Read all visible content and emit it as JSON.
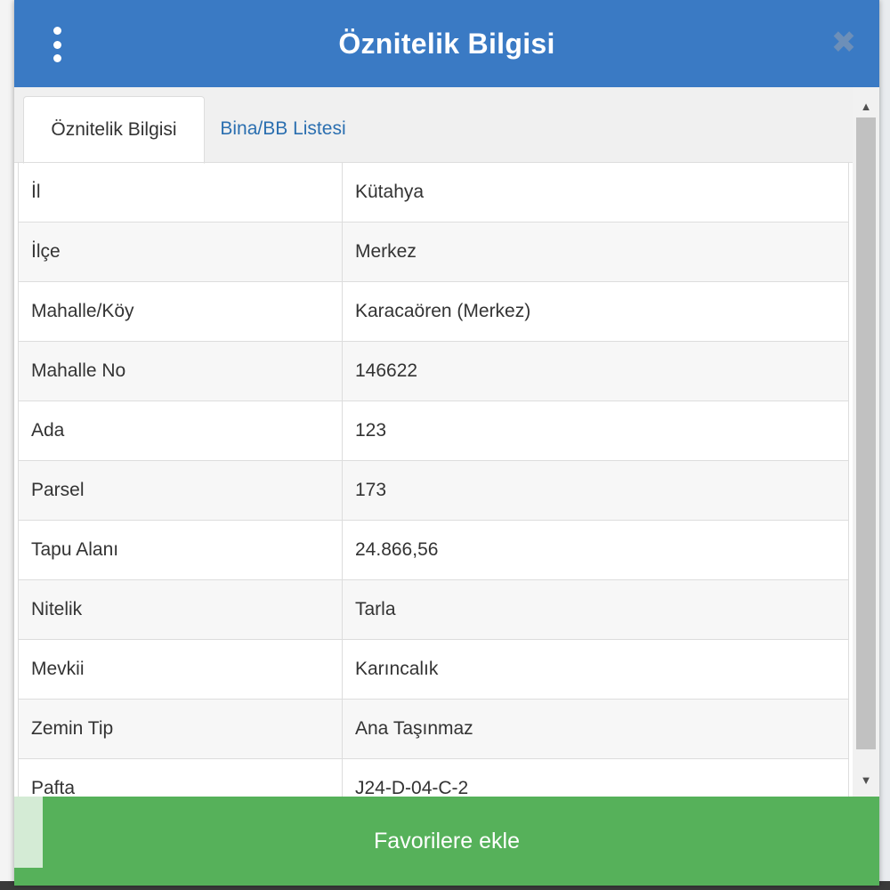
{
  "header": {
    "title": "Öznitelik Bilgisi"
  },
  "tabs": [
    {
      "label": "Öznitelik Bilgisi",
      "active": true
    },
    {
      "label": "Bina/BB Listesi",
      "active": false
    }
  ],
  "attributes": [
    {
      "key": "İl",
      "value": "Kütahya"
    },
    {
      "key": "İlçe",
      "value": "Merkez"
    },
    {
      "key": "Mahalle/Köy",
      "value": "Karacaören (Merkez)"
    },
    {
      "key": "Mahalle No",
      "value": "146622"
    },
    {
      "key": "Ada",
      "value": "123"
    },
    {
      "key": "Parsel",
      "value": "173"
    },
    {
      "key": "Tapu Alanı",
      "value": "24.866,56"
    },
    {
      "key": "Nitelik",
      "value": "Tarla"
    },
    {
      "key": "Mevkii",
      "value": "Karıncalık"
    },
    {
      "key": "Zemin Tip",
      "value": "Ana Taşınmaz"
    },
    {
      "key": "Pafta",
      "value": "J24-D-04-C-2"
    }
  ],
  "footer": {
    "favorite_label": "Favorilere ekle"
  },
  "icons": {
    "menu": "vertical-dots-icon",
    "close": "close-icon",
    "scroll_up": "triangle-up-icon",
    "scroll_down": "triangle-down-icon"
  },
  "colors": {
    "header": "#3a7ac4",
    "tab_link": "#2b6fb0",
    "favorite_button": "#56b15a"
  }
}
